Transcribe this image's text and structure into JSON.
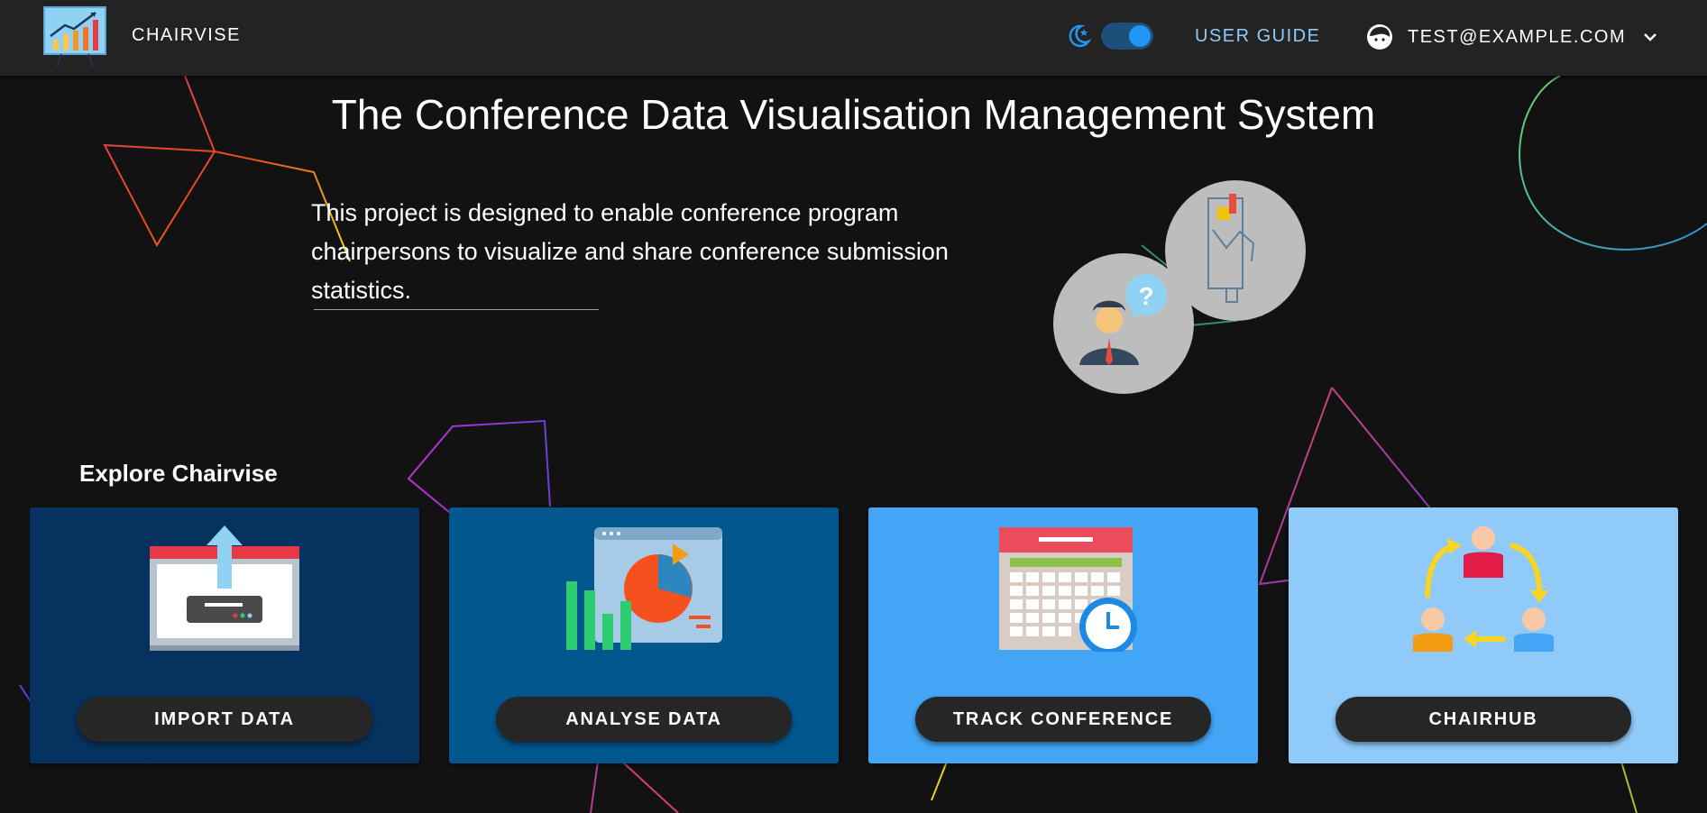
{
  "header": {
    "brand": "CHAIRVISE",
    "user_guide": "USER GUIDE",
    "user_email": "TEST@EXAMPLE.COM",
    "theme_toggle_on": true,
    "icons": [
      "chart-logo-icon",
      "dark-mode-moon-icon",
      "user-avatar-icon",
      "chevron-down-icon"
    ]
  },
  "main": {
    "title": "The Conference Data Visualisation Management System",
    "intro": "This project is designed to enable conference program chairpersons to visualize and share conference submission statistics.",
    "explore_heading": "Explore Chairvise"
  },
  "cards": [
    {
      "label": "IMPORT DATA",
      "color": "#06325f",
      "icon": "import-monitor-icon"
    },
    {
      "label": "ANALYSE DATA",
      "color": "#02578f",
      "icon": "analytics-chart-icon"
    },
    {
      "label": "TRACK CONFERENCE",
      "color": "#42a5f5",
      "icon": "calendar-clock-icon"
    },
    {
      "label": "CHAIRHUB",
      "color": "#90caf9",
      "icon": "team-cycle-icon"
    }
  ],
  "colors": {
    "background": "#121212",
    "topbar": "#232323",
    "accent": "#2196f3",
    "guide_link": "#90caf9"
  }
}
